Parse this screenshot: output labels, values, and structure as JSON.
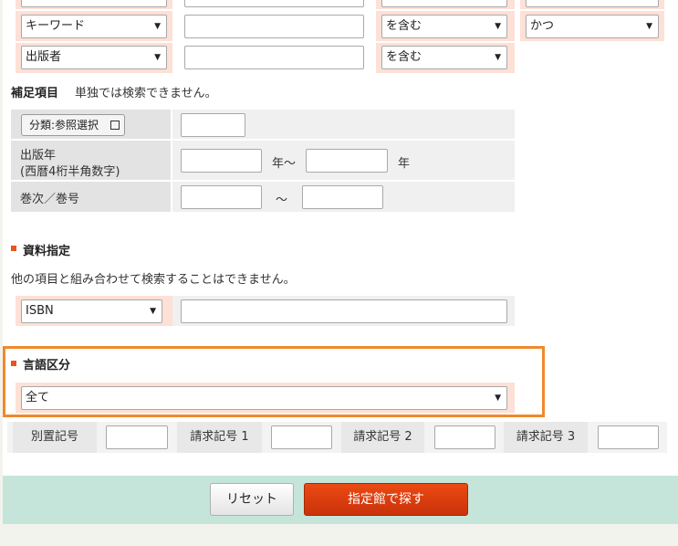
{
  "top_rows": [
    {
      "field": "キーワード",
      "match": "を含む",
      "logic": "かつ"
    },
    {
      "field": "出版者",
      "match": "を含む"
    }
  ],
  "supplement": {
    "heading": "補足項目",
    "note": "単独では検索できません。",
    "ref_button": "分類:参照選択",
    "pub_year_label_1": "出版年",
    "pub_year_label_2": "(西暦4桁半角数字)",
    "year_from_suffix": "年〜",
    "year_to_suffix": "年",
    "volume_label": "巻次／巻号",
    "range_sep": "〜"
  },
  "material": {
    "title": "資料指定",
    "note": "他の項目と組み合わせて検索することはできません。",
    "id_type": "ISBN"
  },
  "language": {
    "title": "言語区分",
    "value": "全て"
  },
  "call_numbers": {
    "label_0": "別置記号",
    "label_1": "請求記号 1",
    "label_2": "請求記号 2",
    "label_3": "請求記号 3"
  },
  "buttons": {
    "reset": "リセット",
    "search": "指定館で探す"
  },
  "colors": {
    "accent": "#e8541c",
    "highlight_border": "#f0892b",
    "row_bg": "#fde0d6",
    "footer_bg": "#c6e5da",
    "search_button": "#d63a0e"
  }
}
